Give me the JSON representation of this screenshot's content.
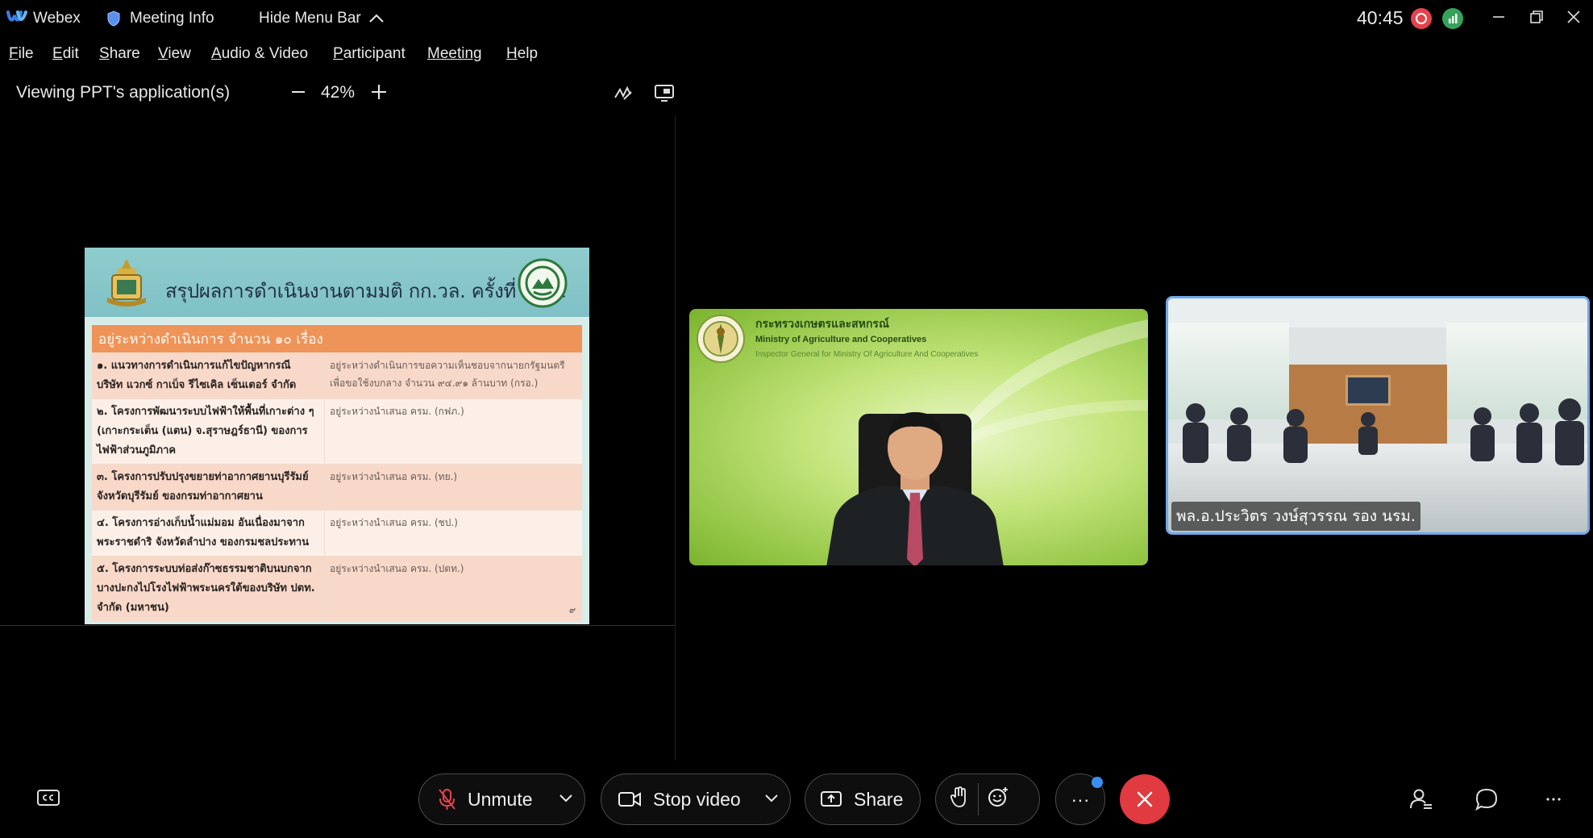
{
  "titlebar": {
    "app_name": "Webex",
    "meeting_info": "Meeting Info",
    "hide_menu_bar": "Hide Menu Bar",
    "timer": "40:45"
  },
  "menu": {
    "items": [
      {
        "pre": "",
        "ul": "F",
        "rest": "ile"
      },
      {
        "pre": "",
        "ul": "E",
        "rest": "dit"
      },
      {
        "pre": "",
        "ul": "S",
        "rest": "hare"
      },
      {
        "pre": "",
        "ul": "V",
        "rest": "iew"
      },
      {
        "pre": "",
        "ul": "A",
        "rest": "udio & Video"
      },
      {
        "pre": "",
        "ul": "P",
        "rest": "articipant"
      },
      {
        "pre": "",
        "ul": "Meeting",
        "rest": ""
      },
      {
        "pre": "",
        "ul": "H",
        "rest": "elp"
      }
    ]
  },
  "share_toolbar": {
    "viewing_text": "Viewing PPT's application(s)",
    "zoom": "42%"
  },
  "slide": {
    "title": "สรุปผลการดำเนินงานตามมติ กก.วล. ครั้งที่ ๖/๖๕",
    "table_header": "อยู่ระหว่างดำเนินการ จำนวน ๑๐ เรื่อง",
    "rows": [
      {
        "project": "๑. แนวทางการดำเนินการแก้ไขปัญหากรณี บริษัท แวกซ์ กาเบ็จ รีไซเคิล เซ็นเตอร์ จำกัด",
        "status": "อยู่ระหว่างดำเนินการขอความเห็นชอบจากนายกรัฐมนตรี เพื่อขอใช้งบกลาง จำนวน ๙๔.๙๑ ล้านบาท (กรอ.)"
      },
      {
        "project": "๒. โครงการพัฒนาระบบไฟฟ้าให้พื้นที่เกาะต่าง ๆ (เกาะกระเต็น (แตน) จ.สุราษฎร์ธานี) ของการไฟฟ้าส่วนภูมิภาค",
        "status": "อยู่ระหว่างนำเสนอ ครม. (กฟภ.)"
      },
      {
        "project": "๓. โครงการปรับปรุงขยายท่าอากาศยานบุรีรัมย์ จังหวัดบุรีรัมย์ ของกรมท่าอากาศยาน",
        "status": "อยู่ระหว่างนำเสนอ ครม. (ทย.)"
      },
      {
        "project": "๔. โครงการอ่างเก็บน้ำแม่มอม อันเนื่องมาจากพระราชดำริ จังหวัดลำปาง ของกรมชลประทาน",
        "status": "อยู่ระหว่างนำเสนอ ครม. (ชป.)"
      },
      {
        "project": "๕. โครงการระบบท่อส่งก๊าซธรรมชาติบนบกจากบางปะกงไปโรงไฟฟ้าพระนครใต้ของบริษัท ปตท. จำกัด (มหาชน)",
        "status": "อยู่ระหว่างนำเสนอ ครม. (ปตท.)"
      }
    ],
    "page_number": "๙"
  },
  "tiles": {
    "org_th": "กระทรวงเกษตรและสหกรณ์",
    "org_en": "Ministry of Agriculture and Cooperatives",
    "org_sub": "Inspector General for Ministry Of Agriculture And Cooperatives",
    "room_name": "พล.อ.ประวิตร วงษ์สุวรรณ รอง นรม."
  },
  "controls": {
    "unmute": "Unmute",
    "stop_video": "Stop video",
    "share": "Share",
    "more": "···"
  },
  "colors": {
    "leave": "#e13a40",
    "active_border": "#6fa9ea",
    "record": "#e6424b",
    "stats": "#36a35a"
  }
}
